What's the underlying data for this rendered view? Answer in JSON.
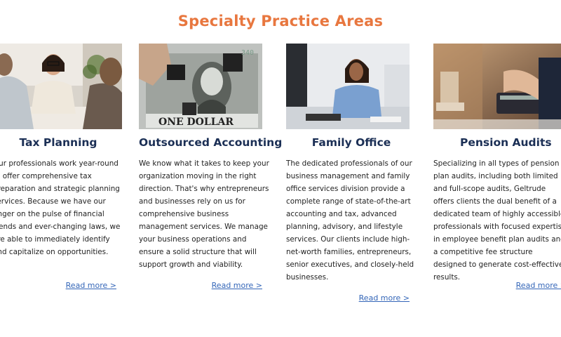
{
  "section": {
    "title": "Specialty Practice Areas"
  },
  "cards": [
    {
      "title": "Tax Planning",
      "image_icon": "meeting-photo",
      "body": "Our professionals work year-round to offer comprehensive tax preparation and strategic planning services. Because we have our finger on the pulse of financial trends and ever-changing laws, we are able to immediately identify and capitalize on opportunities.",
      "link": "Read more >"
    },
    {
      "title": "Outsourced Accounting",
      "image_icon": "dollar-puzzle-photo",
      "body": "We know what it takes to keep your organization moving in the right direction. That's why entrepreneurs and businesses rely on us for comprehensive business management services. We manage your business operations and ensure a solid structure that will support growth and viability.",
      "link": "Read more >"
    },
    {
      "title": "Family Office",
      "image_icon": "professional-woman-photo",
      "body": "The dedicated professionals of our business management and family office services division provide a complete range of state-of-the-art accounting and tax, advanced planning, advisory, and lifestyle services. Our clients include high-net-worth families, entrepreneurs, senior executives, and closely-held businesses.",
      "link": "Read more >"
    },
    {
      "title": "Pension Audits",
      "image_icon": "calculator-hands-photo",
      "body": "Specializing in all types of pension plan audits, including both limited and full-scope audits, Geltrude offers clients the dual benefit of a dedicated team of highly accessible professionals with focused expertise in employee benefit plan audits and a competitive fee structure designed to generate cost-effective results.",
      "link": "Read more >"
    }
  ],
  "colors": {
    "title": "#e8773f",
    "heading": "#1b2f55",
    "link": "#3466b8"
  }
}
